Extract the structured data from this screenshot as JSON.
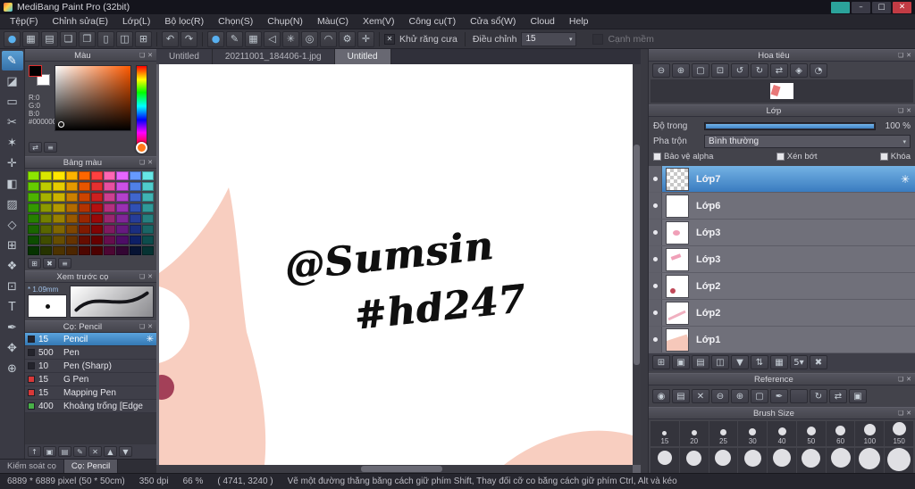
{
  "window": {
    "title": "MediBang Paint Pro (32bit)",
    "controls": [
      {
        "name": "cloud-sync-button",
        "glyph": "",
        "bg": "#2ba39b",
        "color": "#ffffff"
      },
      {
        "name": "minimize-button",
        "glyph": "–",
        "bg": "#3a3a46"
      },
      {
        "name": "maximize-button",
        "glyph": "□",
        "bg": "#3a3a46"
      },
      {
        "name": "close-button",
        "glyph": "✕",
        "bg": "#c23b44",
        "color": "#ffffff"
      }
    ]
  },
  "menubar": {
    "items": [
      "Tệp(F)",
      "Chỉnh sửa(E)",
      "Lớp(L)",
      "Bộ lọc(R)",
      "Chọn(S)",
      "Chụp(N)",
      "Màu(C)",
      "Xem(V)",
      "Công cụ(T)",
      "Cửa sổ(W)",
      "Cloud",
      "Help"
    ]
  },
  "toolbar": {
    "file_icons": [
      {
        "name": "brush-ball-icon",
        "glyph": "●",
        "color": "#5ab2f0"
      },
      {
        "name": "save-icon",
        "glyph": "▦"
      },
      {
        "name": "clipboard-icon",
        "glyph": "▤"
      },
      {
        "name": "speech-bubble-icon",
        "glyph": "❏"
      },
      {
        "name": "note-icon",
        "glyph": "❐"
      },
      {
        "name": "document-icon",
        "glyph": "▯"
      },
      {
        "name": "pages-icon",
        "glyph": "◫"
      },
      {
        "name": "comic-panel-icon",
        "glyph": "⊞"
      }
    ],
    "history_icons": [
      {
        "name": "undo-icon",
        "glyph": "↶"
      },
      {
        "name": "redo-icon",
        "glyph": "↷"
      }
    ],
    "snap_icons": [
      {
        "name": "snap-off-icon",
        "glyph": "●",
        "color": "#58b0f0"
      },
      {
        "name": "brush-stroke-icon",
        "glyph": "✎"
      },
      {
        "name": "snap-parallel-icon",
        "glyph": "▦"
      },
      {
        "name": "snap-angle-icon",
        "glyph": "◁"
      },
      {
        "name": "snap-cross-icon",
        "glyph": "✳"
      },
      {
        "name": "snap-radial-icon",
        "glyph": "◎"
      },
      {
        "name": "snap-curve-icon",
        "glyph": "◠"
      },
      {
        "name": "snap-settings-icon",
        "glyph": "⚙"
      },
      {
        "name": "snap-move-icon",
        "glyph": "✛"
      }
    ],
    "antialias_label": "Khử răng cưa",
    "adjust_label": "Điều chỉnh",
    "adjust_value": "15",
    "soft_edge_label": "Cạnh mềm"
  },
  "toolstrip": {
    "tools": [
      {
        "name": "pen-tool",
        "glyph": "✎",
        "selected": true
      },
      {
        "name": "eraser-tool",
        "glyph": "◪"
      },
      {
        "name": "select-tool",
        "glyph": "▭"
      },
      {
        "name": "lasso-tool",
        "glyph": "✂"
      },
      {
        "name": "magic-wand-tool",
        "glyph": "✶"
      },
      {
        "name": "move-tool",
        "glyph": "✛"
      },
      {
        "name": "fill-tool",
        "glyph": "◧"
      },
      {
        "name": "gradient-tool",
        "glyph": "▨"
      },
      {
        "name": "shape-tool",
        "glyph": "◇"
      },
      {
        "name": "divide-tool",
        "glyph": "⊞"
      },
      {
        "name": "stamp-tool",
        "glyph": "❖"
      },
      {
        "name": "dot-tool",
        "glyph": "⊡"
      },
      {
        "name": "text-tool",
        "glyph": "T"
      },
      {
        "name": "eyedropper-tool",
        "glyph": "✒"
      },
      {
        "name": "hand-tool",
        "glyph": "✥"
      },
      {
        "name": "zoom-tool",
        "glyph": "⊕"
      }
    ]
  },
  "color_panel": {
    "title": "Màu",
    "r_label": "R:0",
    "g_label": "G:0",
    "b_label": "B:0",
    "hex_label": "#000000",
    "buttons": [
      {
        "name": "swap-colors-icon",
        "glyph": "⇄"
      },
      {
        "name": "color-menu-icon",
        "glyph": "≡"
      }
    ]
  },
  "palette_panel": {
    "title": "Bảng màu",
    "colors": [
      "#8ce600",
      "#d9e600",
      "#ffe600",
      "#ffb300",
      "#ff6600",
      "#ff4040",
      "#ff66b3",
      "#e666ff",
      "#6699ff",
      "#66e6e6",
      "#66cc00",
      "#bfcc00",
      "#e6cc00",
      "#e69900",
      "#e65500",
      "#e63030",
      "#e650a0",
      "#cc50e6",
      "#5080e6",
      "#50cccc",
      "#4db300",
      "#a6b300",
      "#ccb300",
      "#cc8000",
      "#cc4400",
      "#cc2020",
      "#cc4090",
      "#b340cc",
      "#4066cc",
      "#40b3b3",
      "#339900",
      "#8c9900",
      "#b39900",
      "#b36b00",
      "#b33300",
      "#b31010",
      "#b33080",
      "#9930b3",
      "#3050b3",
      "#309999",
      "#268000",
      "#738000",
      "#998000",
      "#995900",
      "#992600",
      "#990808",
      "#992670",
      "#802699",
      "#263d99",
      "#268080",
      "#1a6600",
      "#596600",
      "#806600",
      "#804600",
      "#801a00",
      "#800404",
      "#801a60",
      "#661a80",
      "#1a2e80",
      "#1a6666",
      "#0d4d00",
      "#404d00",
      "#664d00",
      "#663300",
      "#660d00",
      "#660000",
      "#660d4d",
      "#4d0d66",
      "#0d1f66",
      "#0d4d4d",
      "#063300",
      "#263300",
      "#4d3300",
      "#4d2600",
      "#4d0600",
      "#4d0000",
      "#4d0633",
      "#330633",
      "#061333",
      "#063333"
    ],
    "buttons": [
      {
        "name": "add-color-icon",
        "glyph": "⊞"
      },
      {
        "name": "delete-color-icon",
        "glyph": "✖"
      },
      {
        "name": "palette-menu-icon",
        "glyph": "≡"
      }
    ]
  },
  "brush_preview_panel": {
    "title": "Xem trước cọ",
    "size_label": "* 1.09mm"
  },
  "brush_panel": {
    "title": "Cọ: Pencil",
    "brushes": [
      {
        "size": "15",
        "name": "Pencil",
        "swatch": "#24242c",
        "selected": true
      },
      {
        "size": "500",
        "name": "Pen",
        "swatch": "#24242c"
      },
      {
        "size": "10",
        "name": "Pen (Sharp)",
        "swatch": "#24242c"
      },
      {
        "size": "15",
        "name": "G Pen",
        "swatch": "#d83838"
      },
      {
        "size": "15",
        "name": "Mapping Pen",
        "swatch": "#d83838"
      },
      {
        "size": "400",
        "name": "Khoảng trống [Edge",
        "swatch": "#48b048"
      }
    ],
    "buttons": [
      {
        "name": "add-brush-icon",
        "glyph": "↑"
      },
      {
        "name": "new-brush-icon",
        "glyph": "▣"
      },
      {
        "name": "brush-folder-icon",
        "glyph": "▤"
      },
      {
        "name": "edit-brush-icon",
        "glyph": "✎"
      },
      {
        "name": "delete-brush-icon",
        "glyph": "✕"
      },
      {
        "name": "brush-up-icon",
        "glyph": "▲"
      },
      {
        "name": "brush-down-icon",
        "glyph": "▼"
      }
    ]
  },
  "left_tabs": [
    {
      "label": "Kiểm soát cọ"
    },
    {
      "label": "Cọ: Pencil",
      "active": true
    }
  ],
  "canvas": {
    "tabs": [
      {
        "label": "Untitled"
      },
      {
        "label": "20211001_184406-1.jpg"
      },
      {
        "label": "Untitled",
        "active": true
      }
    ],
    "annotations": {
      "line1": "@Sumsin",
      "line2": "#hd247"
    },
    "colors": {
      "skin": "#f8cec0",
      "accent_red": "#a34058"
    }
  },
  "navigator_panel": {
    "title": "Hoa tiêu",
    "icons": [
      {
        "name": "nav-zoom-out-icon",
        "glyph": "⊖"
      },
      {
        "name": "nav-zoom-in-icon",
        "glyph": "⊕"
      },
      {
        "name": "nav-zoom-fit-icon",
        "glyph": "▢"
      },
      {
        "name": "nav-zoom-actual-icon",
        "glyph": "⊡"
      },
      {
        "name": "nav-rotate-left-icon",
        "glyph": "↺"
      },
      {
        "name": "nav-rotate-right-icon",
        "glyph": "↻"
      },
      {
        "name": "nav-flip-icon",
        "glyph": "⇄"
      },
      {
        "name": "nav-reset-icon",
        "glyph": "◈"
      },
      {
        "name": "nav-spin-icon",
        "glyph": "◔"
      }
    ]
  },
  "layers_panel": {
    "title": "Lớp",
    "opacity_label": "Độ trong",
    "opacity_value": "100 %",
    "blend_label": "Pha trộn",
    "blend_value": "Bình thường",
    "check_alpha": "Bảo vệ alpha",
    "check_clip": "Xén bớt",
    "check_lock": "Khóa",
    "layers": [
      {
        "name": "Lớp7",
        "selected": true,
        "thumb": "checker"
      },
      {
        "name": "Lớp6",
        "thumb": "plain"
      },
      {
        "name": "Lớp3",
        "thumb": "pink-dot"
      },
      {
        "name": "Lớp3",
        "thumb": "pink-mark"
      },
      {
        "name": "Lớp2",
        "thumb": "red-dot"
      },
      {
        "name": "Lớp2",
        "thumb": "pink-line"
      },
      {
        "name": "Lớp1",
        "thumb": "peach-wedge"
      }
    ],
    "buttons": [
      {
        "name": "add-layer-icon",
        "glyph": "⊞"
      },
      {
        "name": "new-layer-icon",
        "glyph": "▣"
      },
      {
        "name": "add-folder-icon",
        "glyph": "▤"
      },
      {
        "name": "duplicate-layer-icon",
        "glyph": "◫"
      },
      {
        "name": "merge-down-icon",
        "glyph": "▼"
      },
      {
        "name": "move-layer-icon",
        "glyph": "⇅"
      },
      {
        "name": "rasterize-layer-icon",
        "glyph": "▦"
      },
      {
        "name": "layer-depth-icon",
        "glyph": "5▾"
      },
      {
        "name": "delete-layer-icon",
        "glyph": "✖"
      }
    ]
  },
  "reference_panel": {
    "title": "Reference",
    "icons": [
      {
        "name": "ref-import-icon",
        "glyph": "◉"
      },
      {
        "name": "ref-folder-icon",
        "glyph": "▤"
      },
      {
        "name": "ref-close-icon",
        "glyph": "✕"
      },
      {
        "name": "ref-zoom-out-icon",
        "glyph": "⊖"
      },
      {
        "name": "ref-zoom-in-icon",
        "glyph": "⊕"
      },
      {
        "name": "ref-zoom-fit-icon",
        "glyph": "▢"
      },
      {
        "name": "ref-eyedropper-icon",
        "glyph": "✒"
      },
      {
        "name": "ref-hand-icon",
        "gl yph": "✥"
      },
      {
        "name": "ref-rotate-icon",
        "glyph": "↻"
      },
      {
        "name": "ref-flip-icon",
        "glyph": "⇄"
      },
      {
        "name": "ref-reset-icon",
        "glyph": "▣"
      }
    ]
  },
  "brush_size_panel": {
    "title": "Brush Size",
    "sizes": [
      {
        "label": "15",
        "d": 5
      },
      {
        "label": "20",
        "d": 6
      },
      {
        "label": "25",
        "d": 7
      },
      {
        "label": "30",
        "d": 8
      },
      {
        "label": "40",
        "d": 9
      },
      {
        "label": "50",
        "d": 10
      },
      {
        "label": "60",
        "d": 11
      },
      {
        "label": "100",
        "d": 13
      },
      {
        "label": "150",
        "d": 15
      }
    ],
    "sizes_row2": [
      {
        "label": "",
        "d": 16
      },
      {
        "label": "",
        "d": 17
      },
      {
        "label": "",
        "d": 18
      },
      {
        "label": "",
        "d": 19
      },
      {
        "label": "",
        "d": 20
      },
      {
        "label": "",
        "d": 21
      },
      {
        "label": "",
        "d": 22
      },
      {
        "label": "",
        "d": 24
      },
      {
        "label": "",
        "d": 26
      }
    ]
  },
  "statusbar": {
    "size_info": "6889 * 6889 pixel   (50 * 50cm)",
    "dpi": "350 dpi",
    "zoom": "66 %",
    "coords": "( 4741, 3240 )",
    "hint": "Vẽ một đường thẳng bằng cách giữ phím Shift, Thay đổi cỡ co bằng cách giữ phím Ctrl, Alt và kéo"
  }
}
